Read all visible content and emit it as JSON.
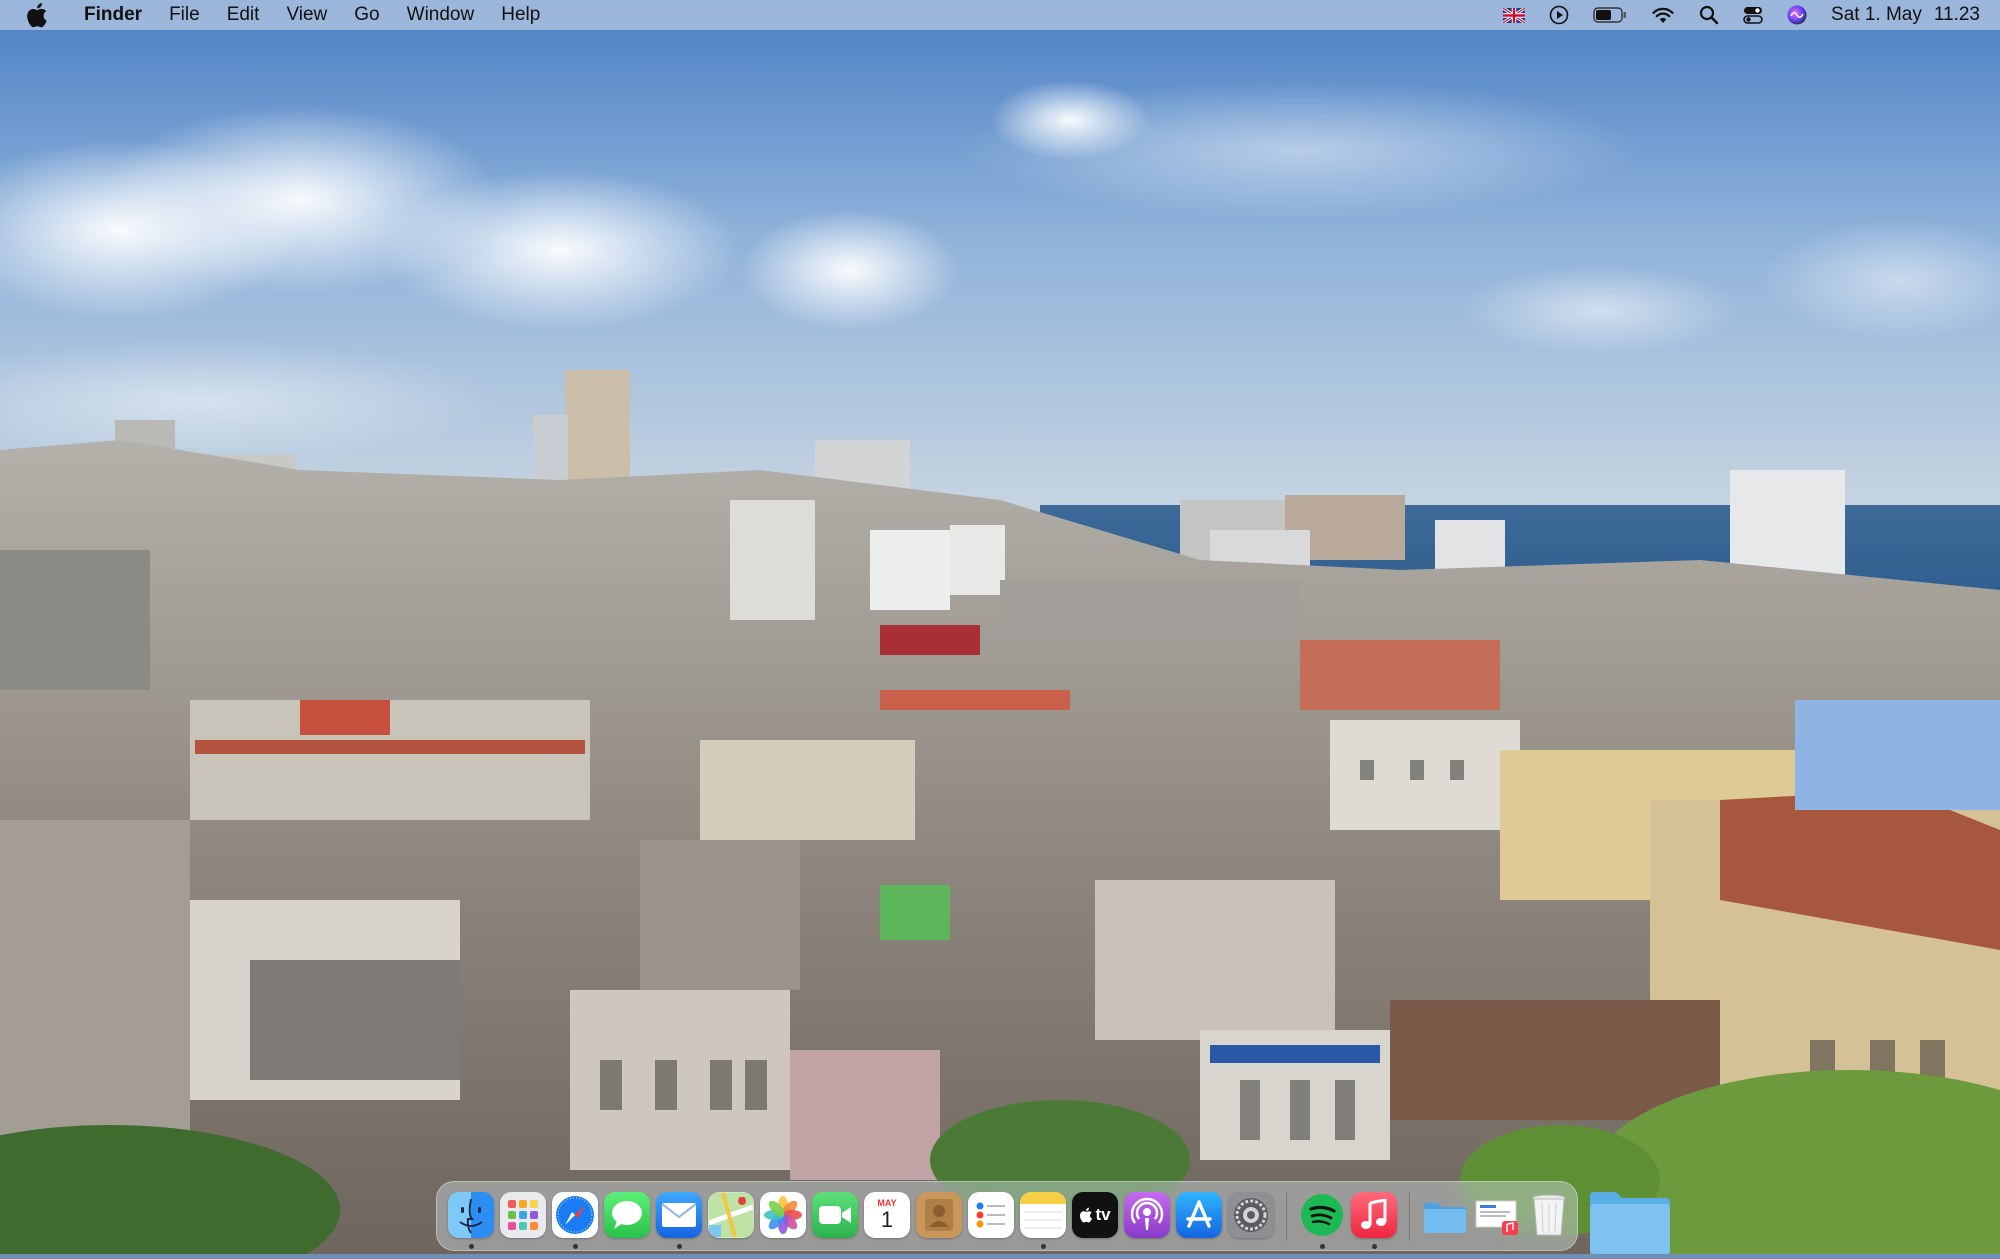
{
  "menubar": {
    "app_name": "Finder",
    "menus": [
      "File",
      "Edit",
      "View",
      "Go",
      "Window",
      "Help"
    ],
    "status_icons": [
      "uk-flag-icon",
      "play-circle-icon",
      "battery-icon",
      "wifi-icon",
      "search-icon",
      "control-center-icon",
      "siri-icon"
    ],
    "date": "Sat 1. May",
    "time": "11.23"
  },
  "dock": {
    "apps": [
      {
        "name": "Finder",
        "icon": "finder-icon",
        "running": true
      },
      {
        "name": "Launchpad",
        "icon": "launchpad-icon",
        "running": false
      },
      {
        "name": "Safari",
        "icon": "safari-icon",
        "running": true
      },
      {
        "name": "Messages",
        "icon": "messages-icon",
        "running": false
      },
      {
        "name": "Mail",
        "icon": "mail-icon",
        "running": true
      },
      {
        "name": "Maps",
        "icon": "maps-icon",
        "running": false
      },
      {
        "name": "Photos",
        "icon": "photos-icon",
        "running": false
      },
      {
        "name": "FaceTime",
        "icon": "facetime-icon",
        "running": false
      },
      {
        "name": "Calendar",
        "icon": "calendar-icon",
        "running": false,
        "month": "MAY",
        "day": "1"
      },
      {
        "name": "Contacts",
        "icon": "contacts-icon",
        "running": false
      },
      {
        "name": "Reminders",
        "icon": "reminders-icon",
        "running": false
      },
      {
        "name": "Notes",
        "icon": "notes-icon",
        "running": true
      },
      {
        "name": "TV",
        "icon": "apple-tv-icon",
        "running": false,
        "label": "tv"
      },
      {
        "name": "Podcasts",
        "icon": "podcasts-icon",
        "running": false
      },
      {
        "name": "App Store",
        "icon": "app-store-icon",
        "running": false
      },
      {
        "name": "System Preferences",
        "icon": "system-preferences-icon",
        "running": false
      },
      {
        "name": "Spotify",
        "icon": "spotify-icon",
        "running": true
      },
      {
        "name": "Music",
        "icon": "music-icon",
        "running": true
      }
    ],
    "others": [
      {
        "name": "Downloads",
        "icon": "folder-stack-icon"
      },
      {
        "name": "Documents",
        "icon": "document-stack-icon"
      },
      {
        "name": "Trash",
        "icon": "trash-icon"
      }
    ],
    "desktop_item": "folder-icon"
  },
  "colors": {
    "menubar": "#dce2ec",
    "safari": "#1a7cf5",
    "messages": "#34c759",
    "spotify": "#1db954",
    "music": "#fa3c4c",
    "podcasts": "#9b4ddb",
    "appstore": "#1c8cf8",
    "folder": "#6ab7ee"
  }
}
